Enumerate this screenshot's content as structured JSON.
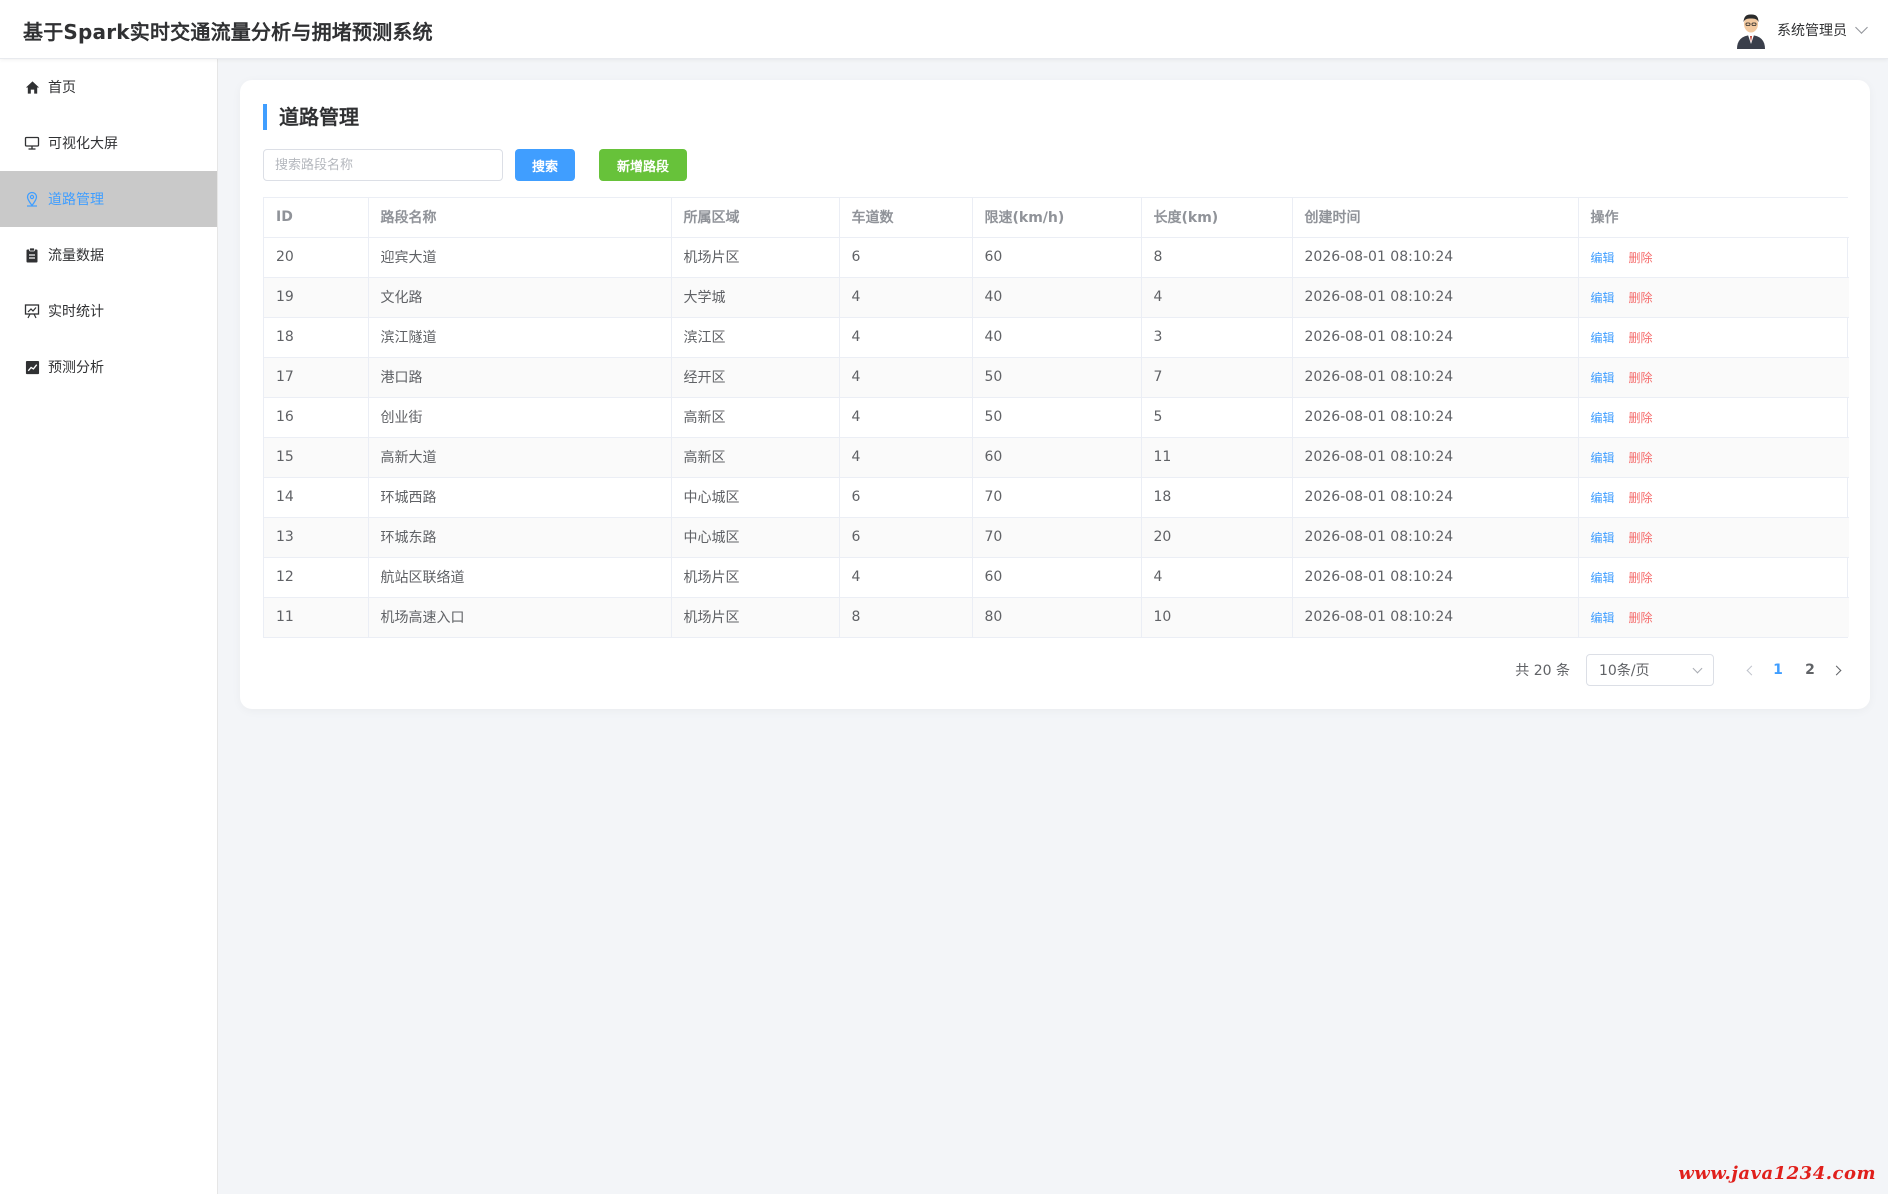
{
  "header": {
    "title": "基于Spark实时交通流量分析与拥堵预测系统",
    "user_name": "系统管理员"
  },
  "sidebar": {
    "items": [
      {
        "label": "首页",
        "icon": "home-icon",
        "active": false
      },
      {
        "label": "可视化大屏",
        "icon": "monitor-icon",
        "active": false
      },
      {
        "label": "道路管理",
        "icon": "location-icon",
        "active": true
      },
      {
        "label": "流量数据",
        "icon": "clipboard-icon",
        "active": false
      },
      {
        "label": "实时统计",
        "icon": "presentation-icon",
        "active": false
      },
      {
        "label": "预测分析",
        "icon": "trend-chart-icon",
        "active": false
      }
    ]
  },
  "main": {
    "title": "道路管理",
    "search_placeholder": "搜索路段名称",
    "search_value": "",
    "search_button": "搜索",
    "add_button": "新增路段",
    "columns": [
      "ID",
      "路段名称",
      "所属区域",
      "车道数",
      "限速(km/h)",
      "长度(km)",
      "创建时间",
      "操作"
    ],
    "rows": [
      {
        "id": "20",
        "name": "迎宾大道",
        "area": "机场片区",
        "lanes": "6",
        "speed": "60",
        "length": "8",
        "created": "2026-08-01 08:10:24"
      },
      {
        "id": "19",
        "name": "文化路",
        "area": "大学城",
        "lanes": "4",
        "speed": "40",
        "length": "4",
        "created": "2026-08-01 08:10:24"
      },
      {
        "id": "18",
        "name": "滨江隧道",
        "area": "滨江区",
        "lanes": "4",
        "speed": "40",
        "length": "3",
        "created": "2026-08-01 08:10:24"
      },
      {
        "id": "17",
        "name": "港口路",
        "area": "经开区",
        "lanes": "4",
        "speed": "50",
        "length": "7",
        "created": "2026-08-01 08:10:24"
      },
      {
        "id": "16",
        "name": "创业街",
        "area": "高新区",
        "lanes": "4",
        "speed": "50",
        "length": "5",
        "created": "2026-08-01 08:10:24"
      },
      {
        "id": "15",
        "name": "高新大道",
        "area": "高新区",
        "lanes": "4",
        "speed": "60",
        "length": "11",
        "created": "2026-08-01 08:10:24"
      },
      {
        "id": "14",
        "name": "环城西路",
        "area": "中心城区",
        "lanes": "6",
        "speed": "70",
        "length": "18",
        "created": "2026-08-01 08:10:24"
      },
      {
        "id": "13",
        "name": "环城东路",
        "area": "中心城区",
        "lanes": "6",
        "speed": "70",
        "length": "20",
        "created": "2026-08-01 08:10:24"
      },
      {
        "id": "12",
        "name": "航站区联络道",
        "area": "机场片区",
        "lanes": "4",
        "speed": "60",
        "length": "4",
        "created": "2026-08-01 08:10:24"
      },
      {
        "id": "11",
        "name": "机场高速入口",
        "area": "机场片区",
        "lanes": "8",
        "speed": "80",
        "length": "10",
        "created": "2026-08-01 08:10:24"
      }
    ],
    "edit_label": "编辑",
    "delete_label": "删除",
    "pagination": {
      "total_text": "共 20 条",
      "page_size": "10条/页",
      "pages": [
        "1",
        "2"
      ],
      "current_page": "1"
    }
  },
  "watermark": "www.java1234.com",
  "colors": {
    "primary": "#409eff",
    "success": "#67c23a",
    "danger": "#f56c6c",
    "active_bg": "#c9c9c9"
  }
}
